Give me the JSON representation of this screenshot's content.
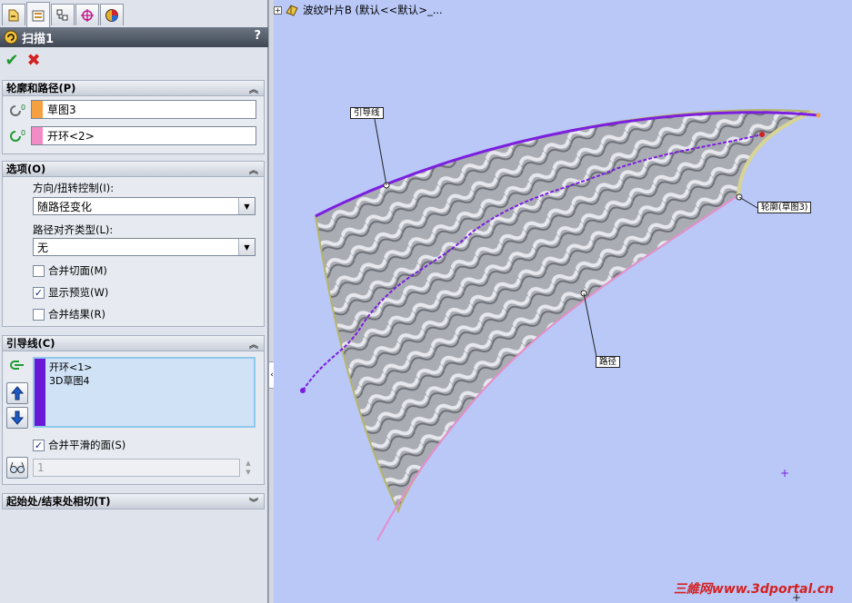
{
  "feature": {
    "title": "扫描1",
    "help": "?"
  },
  "profile_path": {
    "header": "轮廓和路径(P)",
    "profile": "草图3",
    "path": "开环<2>",
    "profile_color": "#f5a040",
    "path_color": "#f28cc4"
  },
  "options": {
    "header": "选项(O)",
    "orient_label": "方向/扭转控制(I):",
    "orient_value": "随路径变化",
    "align_label": "路径对齐类型(L):",
    "align_value": "无",
    "merge_tangent": "合并切面(M)",
    "show_preview": "显示预览(W)",
    "merge_result": "合并结果(R)",
    "merge_tangent_checked": false,
    "show_preview_checked": true,
    "merge_result_checked": false
  },
  "guides": {
    "header": "引导线(C)",
    "items": [
      "开环<1>",
      "3D草图4"
    ],
    "merge_smooth": "合并平滑的面(S)",
    "merge_smooth_checked": true,
    "spin_value": "1",
    "guide_color": "#6a18d8"
  },
  "start_end": {
    "header": "起始处/结束处相切(T)"
  },
  "viewport": {
    "tree_label": "波纹叶片B  (默认<<默认>_...",
    "callout_guide": "引导线",
    "callout_profile": "轮廓(草图3)",
    "callout_path": "路径",
    "watermark": "三維网www.3dportal.cn"
  }
}
